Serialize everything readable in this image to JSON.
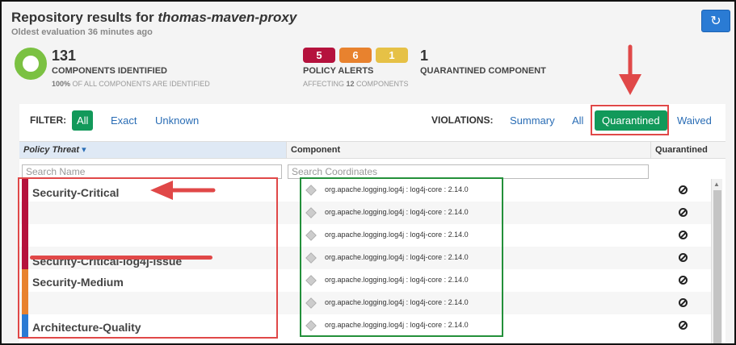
{
  "header": {
    "title_prefix": "Repository results for ",
    "repository": "thomas-maven-proxy",
    "subtitle": "Oldest evaluation 36 minutes ago",
    "refresh_icon": "refresh-icon"
  },
  "stats": {
    "components_count": "131",
    "components_label": "COMPONENTS IDENTIFIED",
    "components_pct": "100%",
    "components_sub": " OF ALL COMPONENTS ARE IDENTIFIED",
    "alerts": [
      {
        "count": "5",
        "color": "#b5123d"
      },
      {
        "count": "6",
        "color": "#e8822e"
      },
      {
        "count": "1",
        "color": "#e6c146"
      }
    ],
    "alerts_label": "POLICY ALERTS",
    "alerts_sub_prefix": "AFFECTING ",
    "alerts_sub_count": "12",
    "alerts_sub_suffix": " COMPONENTS",
    "quarantined_count": "1",
    "quarantined_label": "QUARANTINED COMPONENT"
  },
  "filter": {
    "label": "FILTER:",
    "options": [
      "All",
      "Exact",
      "Unknown"
    ],
    "active": "All"
  },
  "violations": {
    "label": "VIOLATIONS:",
    "options": [
      "Summary",
      "All",
      "Quarantined",
      "Waived"
    ],
    "active": "Quarantined"
  },
  "table": {
    "columns": [
      "Policy Threat",
      "Component",
      "Quarantined"
    ],
    "sort_icon": "sort-desc-icon",
    "search_name_placeholder": "Search Name",
    "search_coord_placeholder": "Search Coordinates",
    "rows": [
      {
        "threat": "Security-Critical",
        "severity_color": "#b5123d",
        "component": "org.apache.logging.log4j : log4j-core : 2.14.0",
        "status_icon": "quarantined-icon"
      },
      {
        "threat": "",
        "severity_color": "#b5123d",
        "component": "org.apache.logging.log4j : log4j-core : 2.14.0",
        "status_icon": "quarantined-icon"
      },
      {
        "threat": "",
        "severity_color": "#b5123d",
        "component": "org.apache.logging.log4j : log4j-core : 2.14.0",
        "status_icon": "quarantined-icon"
      },
      {
        "threat": "Security-Critical-log4j-issue",
        "severity_color": "#b5123d",
        "component": "org.apache.logging.log4j : log4j-core : 2.14.0",
        "status_icon": "quarantined-icon"
      },
      {
        "threat": "Security-Medium",
        "severity_color": "#e8822e",
        "component": "org.apache.logging.log4j : log4j-core : 2.14.0",
        "status_icon": "quarantined-icon"
      },
      {
        "threat": "",
        "severity_color": "#e8822e",
        "component": "org.apache.logging.log4j : log4j-core : 2.14.0",
        "status_icon": "quarantined-icon"
      },
      {
        "threat": "Architecture-Quality",
        "severity_color": "#2a7bd4",
        "component": "org.apache.logging.log4j : log4j-core : 2.14.0",
        "status_icon": "quarantined-icon"
      }
    ]
  },
  "annotation_colors": {
    "red": "#e04848",
    "green": "#23903a"
  }
}
